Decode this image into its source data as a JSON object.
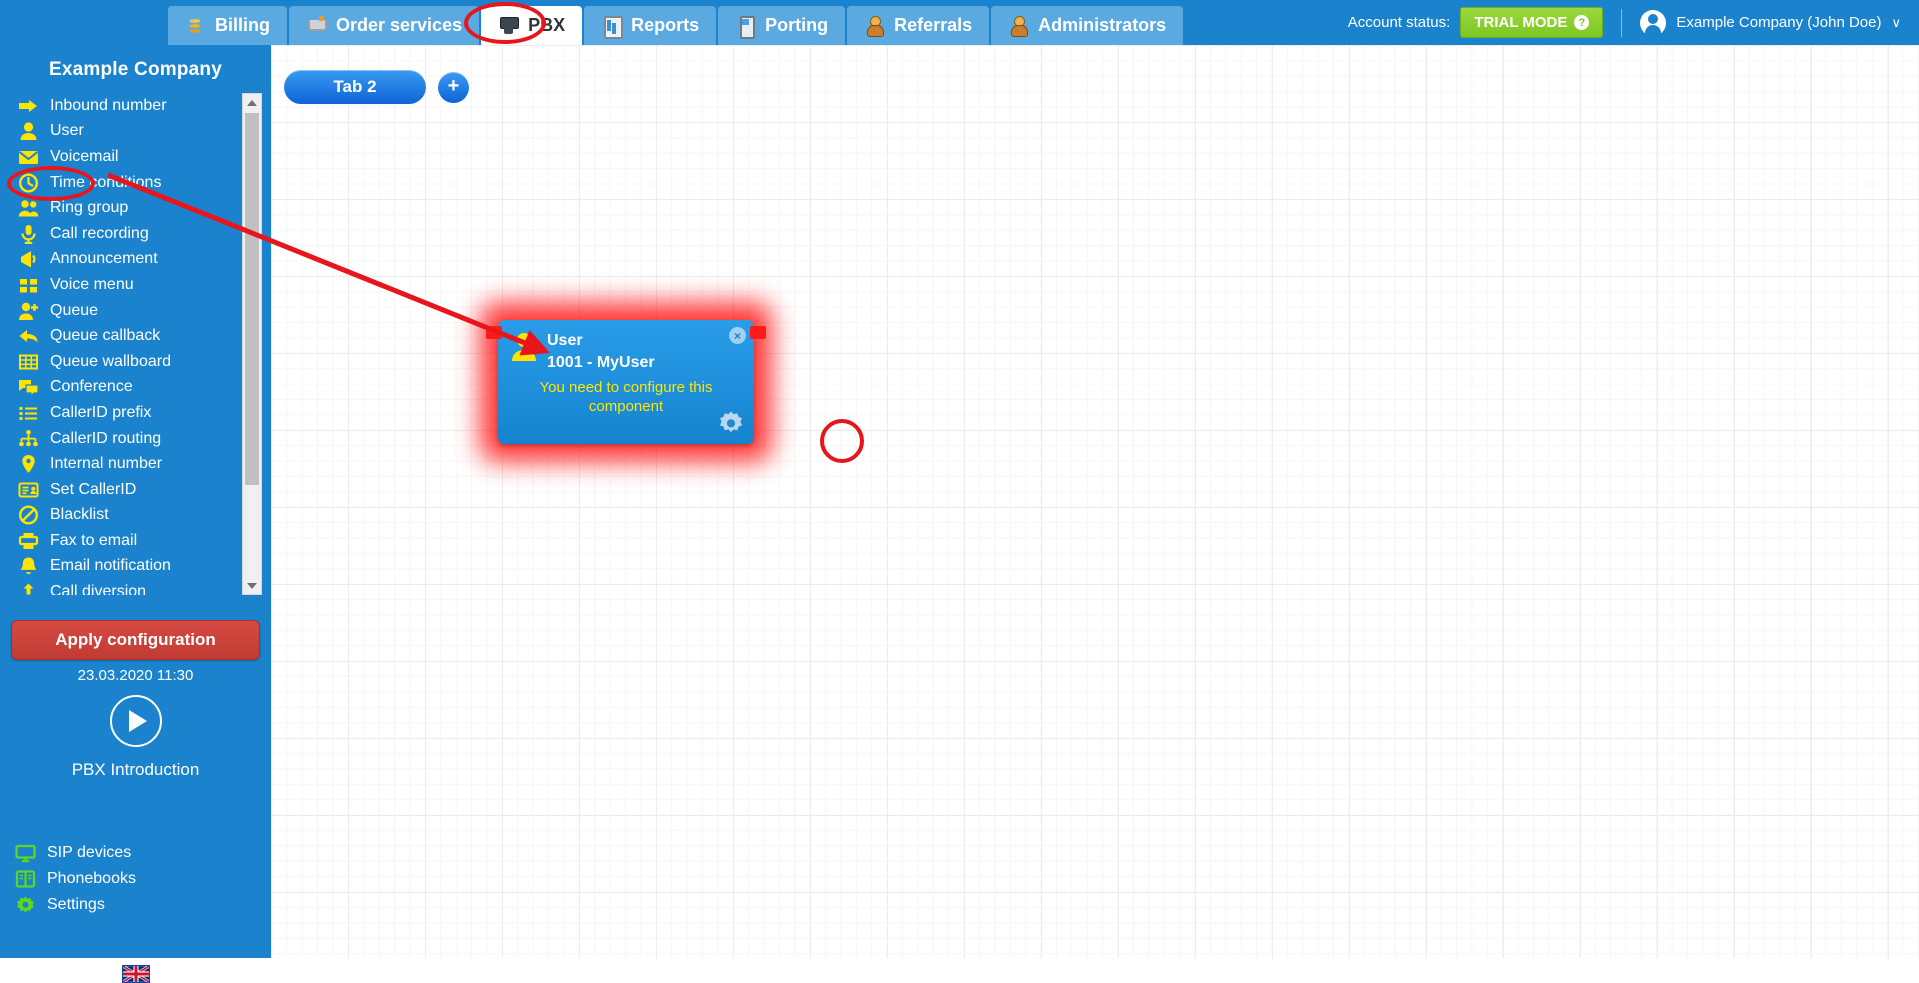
{
  "topbar": {
    "tabs": [
      {
        "label": "Billing",
        "icon": "coins-icon",
        "active": false
      },
      {
        "label": "Order services",
        "icon": "cart-icon",
        "active": false
      },
      {
        "label": "PBX",
        "icon": "pbx-icon",
        "active": true
      },
      {
        "label": "Reports",
        "icon": "report-icon",
        "active": false
      },
      {
        "label": "Porting",
        "icon": "mobile-phone-icon",
        "active": false
      },
      {
        "label": "Referrals",
        "icon": "person-badge-icon",
        "active": false
      },
      {
        "label": "Administrators",
        "icon": "person-badge-icon",
        "active": false
      }
    ],
    "account_status_label": "Account status:",
    "trial_badge": "TRIAL MODE",
    "trial_help_glyph": "?",
    "account_user": "Example Company (John Doe)",
    "account_chevron": "∨"
  },
  "sidebar": {
    "company": "Example Company",
    "menu_items": [
      {
        "label": "Inbound number",
        "icon": "arrow-right-icon"
      },
      {
        "label": "User",
        "icon": "user-icon"
      },
      {
        "label": "Voicemail",
        "icon": "envelope-icon"
      },
      {
        "label": "Time conditions",
        "icon": "clock-icon"
      },
      {
        "label": "Ring group",
        "icon": "users-group-icon"
      },
      {
        "label": "Call recording",
        "icon": "microphone-icon"
      },
      {
        "label": "Announcement",
        "icon": "megaphone-icon"
      },
      {
        "label": "Voice menu",
        "icon": "grid-squares-icon"
      },
      {
        "label": "Queue",
        "icon": "user-plus-icon"
      },
      {
        "label": "Queue callback",
        "icon": "arrow-back-icon"
      },
      {
        "label": "Queue wallboard",
        "icon": "table-grid-icon"
      },
      {
        "label": "Conference",
        "icon": "chat-bubbles-icon"
      },
      {
        "label": "CallerID prefix",
        "icon": "list-icon"
      },
      {
        "label": "CallerID routing",
        "icon": "sitemap-icon"
      },
      {
        "label": "Internal number",
        "icon": "map-pin-icon"
      },
      {
        "label": "Set CallerID",
        "icon": "id-card-icon"
      },
      {
        "label": "Blacklist",
        "icon": "no-entry-icon"
      },
      {
        "label": "Fax to email",
        "icon": "printer-icon"
      },
      {
        "label": "Email notification",
        "icon": "bell-icon"
      },
      {
        "label": "Call diversion",
        "icon": "call-diversion-icon"
      }
    ],
    "apply_button": "Apply configuration",
    "apply_timestamp": "23.03.2020 11:30",
    "intro_label": "PBX Introduction",
    "bottom_items": [
      {
        "label": "SIP devices",
        "icon": "monitor-icon"
      },
      {
        "label": "Phonebooks",
        "icon": "book-icon"
      },
      {
        "label": "Settings",
        "icon": "gear-icon"
      }
    ],
    "language_flag": "uk-flag-icon"
  },
  "canvas": {
    "tab_label": "Tab 2",
    "add_tab_glyph": "+",
    "node": {
      "title": "User",
      "subtitle": "1001 - MyUser",
      "warning": "You need to configure this component",
      "close_glyph": "×",
      "gear_icon": "gear-icon"
    }
  },
  "annotations": {
    "highlight_pbx_tab": "red-ellipse",
    "highlight_user_menu": "red-ellipse",
    "highlight_node_gear": "red-ellipse",
    "arrow_from_user_to_node": "red-arrow"
  },
  "colors": {
    "header_blue": "#1b83cd",
    "tab_blue": "#5aa9e0",
    "sidebar_blue": "#1b83cd",
    "menu_icon_yellow": "#ffe400",
    "bottom_icon_green": "#5ed622",
    "apply_red": "#c13b33",
    "trial_green": "#7ec624",
    "node_blue": "#1584cf",
    "node_warning_yellow": "#ffe400",
    "annotation_red": "#e8151b"
  }
}
